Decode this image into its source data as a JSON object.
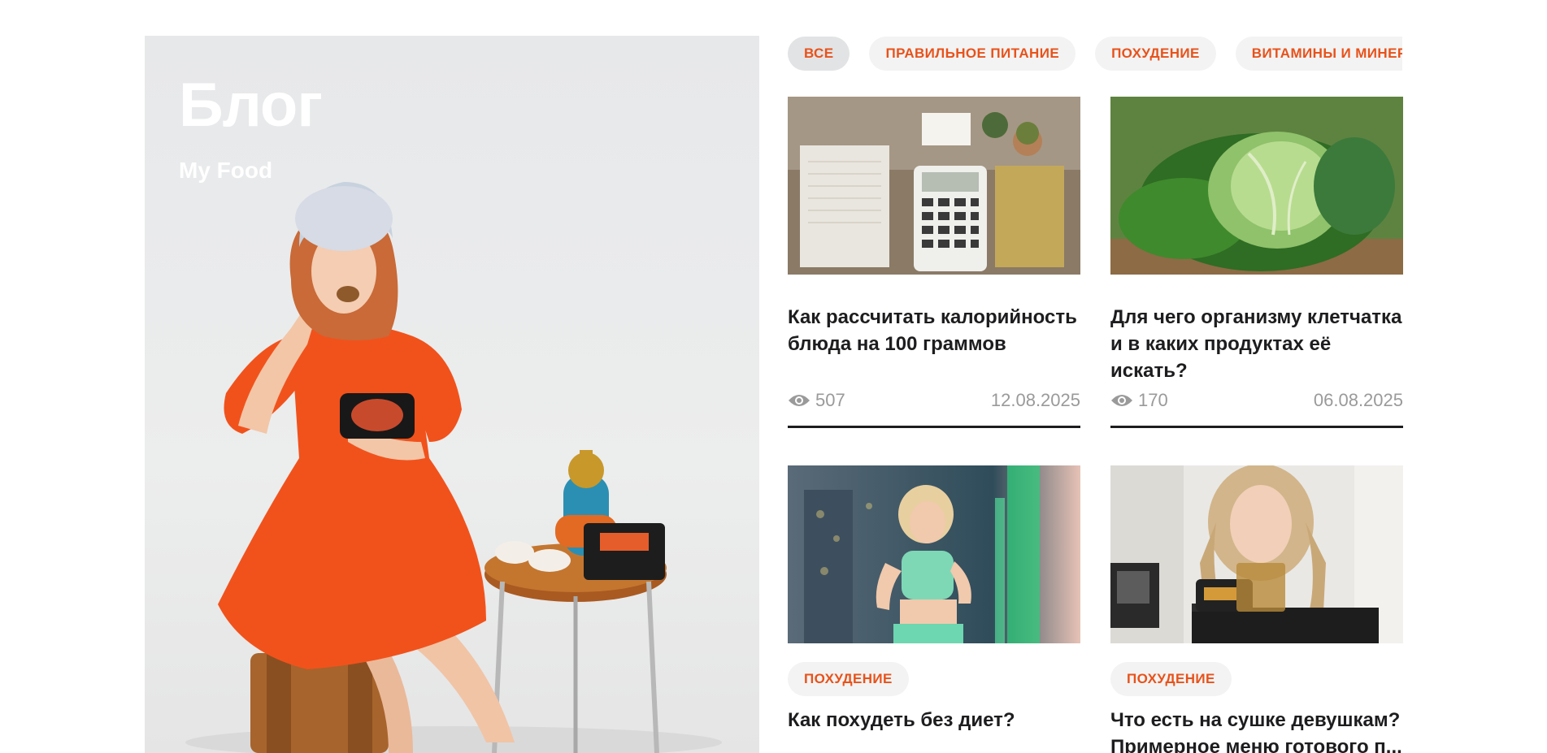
{
  "hero": {
    "title": "Блог",
    "subtitle": "My Food"
  },
  "filters": [
    {
      "label": "ВСЕ",
      "active": true
    },
    {
      "label": "ПРАВИЛЬНОЕ ПИТАНИЕ",
      "active": false
    },
    {
      "label": "ПОХУДЕНИЕ",
      "active": false
    },
    {
      "label": "ВИТАМИНЫ И МИНЕРАЛЫ",
      "active": false
    }
  ],
  "articles": [
    {
      "title": "Как рассчитать калорийность блюда на 100 граммов",
      "views": "507",
      "date": "12.08.2025",
      "image": "calculator-notebook-plants"
    },
    {
      "title": "Для чего организму клетчатка и в каких продуктах её искать?",
      "views": "170",
      "date": "06.08.2025",
      "image": "cabbage"
    },
    {
      "tag": "ПОХУДЕНИЕ",
      "title": "Как похудеть без диет?",
      "image": "woman-running-city"
    },
    {
      "tag": "ПОХУДЕНИЕ",
      "title": "Что есть на сушке девушкам? Примерное меню готового п...",
      "image": "woman-unpacking-food"
    }
  ],
  "colors": {
    "accent": "#e8521a",
    "text": "#1d1d1f",
    "muted": "#9a9a9a",
    "tag_bg": "#f3f3f3"
  }
}
